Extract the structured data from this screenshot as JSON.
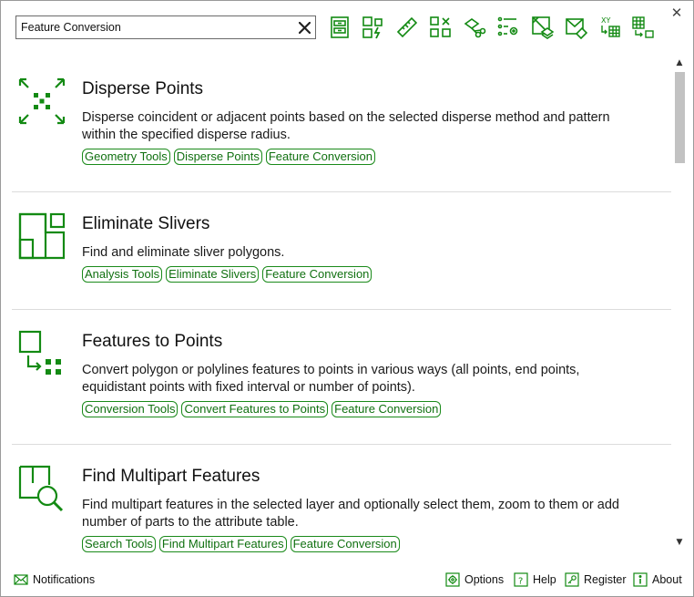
{
  "search": {
    "value": "Feature Conversion"
  },
  "window": {
    "close_symbol": "✕"
  },
  "toolbar": [
    {
      "icon": "cabinet-icon",
      "name": "toolbar-cabinet-button"
    },
    {
      "icon": "shapes-flash-icon",
      "name": "toolbar-shapes-flash-button"
    },
    {
      "icon": "ruler-icon",
      "name": "toolbar-ruler-button"
    },
    {
      "icon": "boxes-x-icon",
      "name": "toolbar-boxes-x-button"
    },
    {
      "icon": "scissors-icon",
      "name": "toolbar-scissors-button"
    },
    {
      "icon": "settings-list-icon",
      "name": "toolbar-settings-list-button"
    },
    {
      "icon": "map-layers-icon",
      "name": "toolbar-map-layers-button"
    },
    {
      "icon": "map-edit-icon",
      "name": "toolbar-map-edit-button"
    },
    {
      "icon": "xy-table-icon",
      "name": "toolbar-xy-table-button"
    },
    {
      "icon": "grid-export-icon",
      "name": "toolbar-grid-export-button"
    }
  ],
  "items": [
    {
      "title": "Disperse Points",
      "description": "Disperse coincident or adjacent points based on the selected disperse method and pattern within the specified disperse radius.",
      "tags": [
        "Geometry Tools",
        "Disperse Points",
        "Feature Conversion"
      ]
    },
    {
      "title": "Eliminate Slivers",
      "description": "Find and eliminate sliver polygons.",
      "tags": [
        "Analysis Tools",
        "Eliminate Slivers",
        "Feature Conversion"
      ]
    },
    {
      "title": "Features to Points",
      "description": "Convert polygon or polylines features to points in various ways (all points, end points, equidistant points with fixed interval or number of points).",
      "tags": [
        "Conversion Tools",
        "Convert Features to Points",
        "Feature Conversion"
      ]
    },
    {
      "title": "Find Multipart Features",
      "description": "Find multipart features in the selected layer and optionally select them, zoom to them or add number of parts to the attribute table.",
      "tags": [
        "Search Tools",
        "Find Multipart Features",
        "Feature Conversion"
      ]
    }
  ],
  "footer": {
    "notifications": "Notifications",
    "options": "Options",
    "help": "Help",
    "register": "Register",
    "about": "About"
  },
  "colors": {
    "accent": "#1a8a1a",
    "icon_green": "#138a13"
  }
}
